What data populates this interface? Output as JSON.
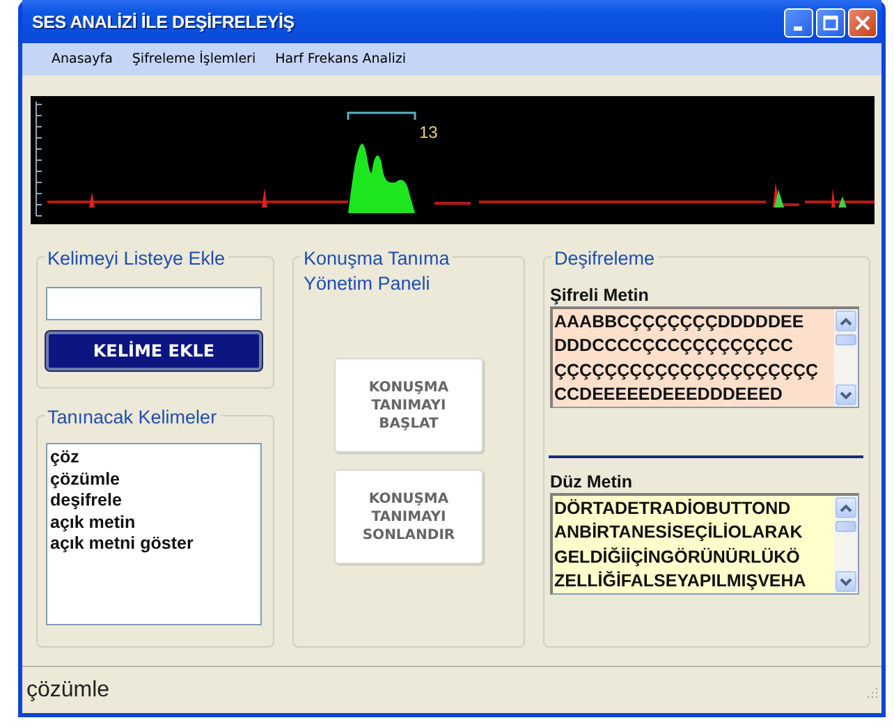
{
  "window": {
    "title": "SES ANALİZİ İLE DEŞİFRELEYİŞ"
  },
  "menu": [
    {
      "label": "Anasayfa"
    },
    {
      "label": "Şifreleme İşlemleri"
    },
    {
      "label": "Harf Frekans Analizi"
    }
  ],
  "waveform": {
    "peak_label": "13"
  },
  "add_word": {
    "title": "Kelimeyi Listeye Ekle",
    "button": "KELİME EKLE"
  },
  "word_list": {
    "title": "Tanınacak Kelimeler",
    "items": [
      "çöz",
      "çözümle",
      "deşifrele",
      "açık metin",
      "açık metni göster"
    ]
  },
  "recognition_panel": {
    "title": "Konuşma Tanıma\nYönetim Paneli",
    "buttons": [
      "KONUŞMA\nTANIMAYI\nBAŞLAT",
      "KONUŞMA\nTANIMAYI\nSONLANDIR"
    ]
  },
  "decryption": {
    "title": "Deşifreleme",
    "cipher": {
      "label": "Şifreli Metin",
      "lines": [
        "AAABBCÇÇÇÇÇÇÇDDDDDEE",
        "DDDCCCCÇCCÇÇÇÇÇÇÇCC",
        "ÇÇÇÇÇÇÇÇÇÇÇÇÇÇÇÇÇÇÇÇÇ",
        "CCDEEEEEDEEEDDDEEED"
      ]
    },
    "plain": {
      "label": "Düz Metin",
      "lines": [
        "DÖRTADETRADİOBUTTOND",
        "ANBİRTANESİSEÇİLİOLARAK",
        "GELDİĞİİÇİNGÖRÜNÜRLÜKÖ",
        "ZELLİĞİFALSEYAPILMIŞVEHA"
      ]
    }
  },
  "status_bar": {
    "text": "çözümle"
  }
}
